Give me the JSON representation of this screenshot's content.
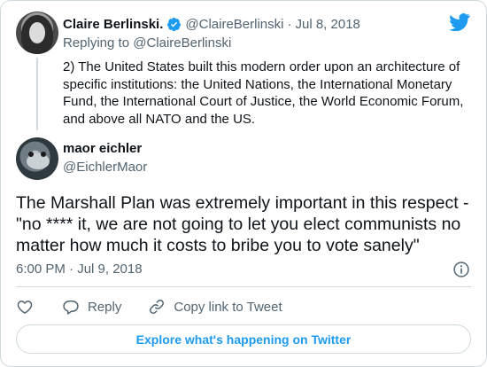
{
  "parent": {
    "name": "Claire Berlinski.",
    "handle": "@ClaireBerlinski",
    "separator": "·",
    "date": "Jul 8, 2018",
    "replying_prefix": "Replying to",
    "replying_handle": "@ClaireBerlinski",
    "text": "2) The United States built this modern order upon an architecture of specific institutions: the United Nations, the International Monetary Fund, the International Court of Justice, the World Economic Forum, and above all NATO and the US."
  },
  "tweet": {
    "name": "maor eichler",
    "handle": "@EichlerMaor",
    "text": "The Marshall Plan was extremely important in this respect - \"no **** it, we are not going to let you elect communists no matter how much it costs to bribe you to vote sanely\"",
    "timestamp": "6:00 PM · Jul 9, 2018"
  },
  "actions": {
    "reply_label": "Reply",
    "copy_label": "Copy link to Tweet"
  },
  "explore_label": "Explore what's happening on Twitter",
  "colors": {
    "accent": "#1d9bf0",
    "secondary_text": "#536471",
    "border": "#cfd9de"
  },
  "icons": [
    "twitter-bird-icon",
    "verified-badge-icon",
    "info-icon",
    "heart-icon",
    "reply-bubble-icon",
    "link-icon"
  ]
}
